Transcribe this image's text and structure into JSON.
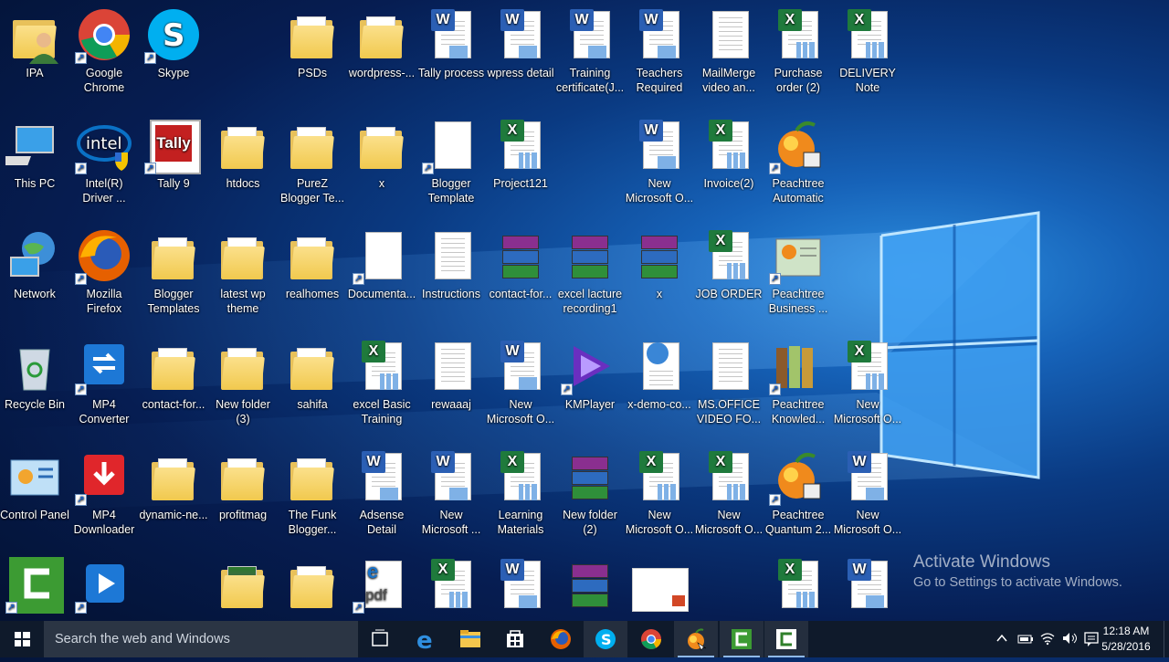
{
  "desktop": {
    "icons": [
      {
        "label": "IPA",
        "type": "person"
      },
      {
        "label": "Google Chrome",
        "type": "chrome",
        "shortcut": true
      },
      {
        "label": "Skype",
        "type": "skype",
        "shortcut": true
      },
      {
        "label": "PSDs",
        "type": "folder"
      },
      {
        "label": "wordpress-...",
        "type": "folder"
      },
      {
        "label": "Tally process",
        "type": "word"
      },
      {
        "label": "wpress detail",
        "type": "word"
      },
      {
        "label": "Training certificate(J...",
        "type": "word"
      },
      {
        "label": "Teachers Required",
        "type": "word"
      },
      {
        "label": "MailMerge video an...",
        "type": "text"
      },
      {
        "label": "Purchase order (2)",
        "type": "excel"
      },
      {
        "label": "DELIVERY Note",
        "type": "excel"
      },
      {
        "label": "This PC",
        "type": "pc"
      },
      {
        "label": "Intel(R) Driver ...",
        "type": "intel",
        "shortcut": true
      },
      {
        "label": "Tally 9",
        "type": "tally",
        "shortcut": true
      },
      {
        "label": "htdocs",
        "type": "folder"
      },
      {
        "label": "PureZ Blogger Te...",
        "type": "folder"
      },
      {
        "label": "x",
        "type": "folder"
      },
      {
        "label": "Blogger Template",
        "type": "blank",
        "shortcut": true
      },
      {
        "label": "Project121",
        "type": "excel"
      },
      {
        "label": "New Microsoft O...",
        "type": "word"
      },
      {
        "label": "Invoice(2)",
        "type": "excel"
      },
      {
        "label": "Peachtree Automatic B...",
        "type": "peach",
        "shortcut": true
      },
      {
        "label": "Network",
        "type": "network"
      },
      {
        "label": "Mozilla Firefox",
        "type": "firefox",
        "shortcut": true
      },
      {
        "label": "Blogger Templates",
        "type": "folder"
      },
      {
        "label": "latest wp theme",
        "type": "folder"
      },
      {
        "label": "realhomes",
        "type": "folder"
      },
      {
        "label": "Documenta...",
        "type": "blank",
        "shortcut": true
      },
      {
        "label": "Instructions",
        "type": "text"
      },
      {
        "label": "contact-for...",
        "type": "rar"
      },
      {
        "label": "excel lacture recording1",
        "type": "rar"
      },
      {
        "label": "x",
        "type": "rar"
      },
      {
        "label": "JOB ORDER",
        "type": "excel"
      },
      {
        "label": "Peachtree Business ...",
        "type": "peachcard",
        "shortcut": true
      },
      {
        "label": "Recycle Bin",
        "type": "bin"
      },
      {
        "label": "MP4 Converter",
        "type": "mp4conv",
        "shortcut": true
      },
      {
        "label": "contact-for...",
        "type": "folder"
      },
      {
        "label": "New folder (3)",
        "type": "folder"
      },
      {
        "label": "sahifa",
        "type": "folder"
      },
      {
        "label": "excel Basic Training",
        "type": "excel"
      },
      {
        "label": "rewaaaj",
        "type": "text"
      },
      {
        "label": "New Microsoft O...",
        "type": "word"
      },
      {
        "label": "KMPlayer",
        "type": "kmplayer",
        "shortcut": true
      },
      {
        "label": "x-demo-co...",
        "type": "html"
      },
      {
        "label": "MS.OFFICE VIDEO FO...",
        "type": "text"
      },
      {
        "label": "Peachtree Knowled...",
        "type": "books",
        "shortcut": true
      },
      {
        "label": "New Microsoft O...",
        "type": "excel"
      },
      {
        "label": "Control Panel",
        "type": "control"
      },
      {
        "label": "MP4 Downloader",
        "type": "mp4down",
        "shortcut": true
      },
      {
        "label": "dynamic-ne...",
        "type": "folder"
      },
      {
        "label": "profitmag",
        "type": "folder"
      },
      {
        "label": "The Funk Blogger...",
        "type": "folder"
      },
      {
        "label": "Adsense Detail",
        "type": "word"
      },
      {
        "label": "New Microsoft ...",
        "type": "word"
      },
      {
        "label": "Learning Materials",
        "type": "excel"
      },
      {
        "label": "New folder (2)",
        "type": "rar"
      },
      {
        "label": "New Microsoft O...",
        "type": "excel"
      },
      {
        "label": "New Microsoft O...",
        "type": "excel"
      },
      {
        "label": "Peachtree Quantum 2...",
        "type": "peach",
        "shortcut": true
      },
      {
        "label": "New Microsoft O...",
        "type": "word"
      },
      {
        "label": "",
        "type": "camtasia",
        "shortcut": true
      },
      {
        "label": "",
        "type": "player",
        "shortcut": true
      },
      {
        "label": "",
        "type": "folderbook"
      },
      {
        "label": "",
        "type": "folder"
      },
      {
        "label": "",
        "type": "pdf",
        "shortcut": true
      },
      {
        "label": "",
        "type": "excel"
      },
      {
        "label": "",
        "type": "word"
      },
      {
        "label": "",
        "type": "rar"
      },
      {
        "label": "",
        "type": "ppt"
      },
      {
        "label": "",
        "type": "excel"
      },
      {
        "label": "",
        "type": "word"
      }
    ]
  },
  "watermark": {
    "title": "Activate Windows",
    "subtitle": "Go to Settings to activate Windows."
  },
  "taskbar": {
    "search_placeholder": "Search the web and Windows",
    "apps": [
      "task-view",
      "edge",
      "file-explorer",
      "store",
      "firefox",
      "skype",
      "chrome",
      "peachtree",
      "camtasia",
      "camtasia-recorder"
    ],
    "clock_time": "12:18 AM",
    "clock_date": "5/28/2016"
  }
}
